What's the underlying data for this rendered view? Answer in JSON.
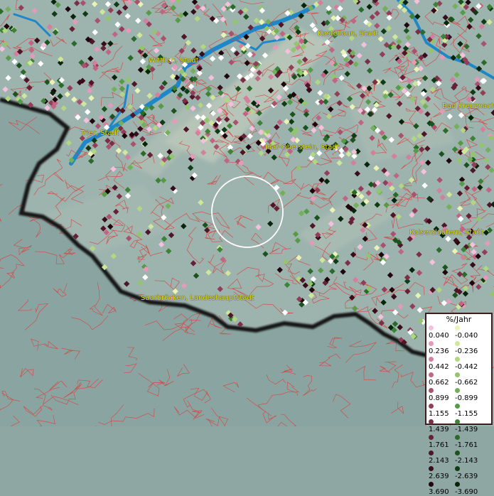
{
  "places": [
    {
      "name": "Kastellaun, Stadt"
    },
    {
      "name": "Wittlich, Stadt"
    },
    {
      "name": "Bad Kreuznach"
    },
    {
      "name": "Trier, Stadt"
    },
    {
      "name": "Idar-Oberstein, Stadt"
    },
    {
      "name": "Kaiserslautern, Stadt"
    },
    {
      "name": "Saarbrücken, Landeshauptstadt"
    }
  ],
  "legend": {
    "title": "%/Jahr",
    "positive": [
      {
        "value": "0.040",
        "color": "#f4c0dc"
      },
      {
        "value": "0.236",
        "color": "#e59ab9"
      },
      {
        "value": "0.442",
        "color": "#d47f9c"
      },
      {
        "value": "0.662",
        "color": "#c06684"
      },
      {
        "value": "0.899",
        "color": "#a9516d"
      },
      {
        "value": "1.155",
        "color": "#923e58"
      },
      {
        "value": "1.439",
        "color": "#7b2e46"
      },
      {
        "value": "1.761",
        "color": "#652136"
      },
      {
        "value": "2.143",
        "color": "#4e1627"
      },
      {
        "value": "2.639",
        "color": "#380d1a"
      },
      {
        "value": "3.690",
        "color": "#21050d"
      }
    ],
    "negative": [
      {
        "value": "-0.040",
        "color": "#e8f3b4"
      },
      {
        "value": "-0.236",
        "color": "#cfe79a"
      },
      {
        "value": "-0.442",
        "color": "#b1d783"
      },
      {
        "value": "-0.662",
        "color": "#93c56d"
      },
      {
        "value": "-0.899",
        "color": "#74b059"
      },
      {
        "value": "-1.155",
        "color": "#579a47"
      },
      {
        "value": "-1.439",
        "color": "#3e8237"
      },
      {
        "value": "-1.761",
        "color": "#2a6a2a"
      },
      {
        "value": "-2.143",
        "color": "#1b531f"
      },
      {
        "value": "-2.639",
        "color": "#0f3c15"
      },
      {
        "value": "-3.690",
        "color": "#06250b"
      }
    ]
  },
  "colors": {
    "terrain": "#9db3ae",
    "outside": "#8aa5a1",
    "border_red": "#d9413f",
    "rivers": "#1e87c8",
    "country_border": "#161616",
    "focus_circle": "#ffffff",
    "label": "#e6e600"
  }
}
